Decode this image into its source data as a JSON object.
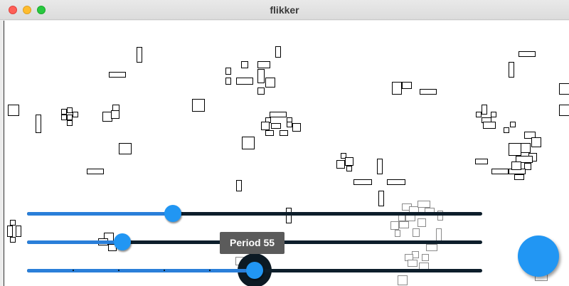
{
  "window": {
    "title": "flikker"
  },
  "sliders": [
    {
      "name": "slider-1",
      "value_fraction": 0.32
    },
    {
      "name": "slider-2",
      "value_fraction": 0.21
    },
    {
      "name": "slider-period",
      "value_fraction": 0.5,
      "tooltip": "Period 55"
    }
  ],
  "colors": {
    "accent": "#2196f3",
    "track": "#0d1e2b",
    "fill": "#2a7fd9",
    "tooltip_bg": "#5b5b5b"
  },
  "icons": {
    "fab": "circle-button"
  }
}
